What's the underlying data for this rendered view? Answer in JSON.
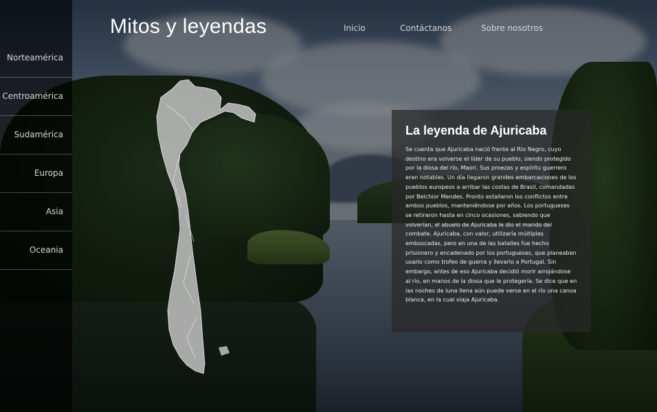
{
  "site": {
    "title": "Mitos y leyendas"
  },
  "top_nav": [
    {
      "label": "Inicio"
    },
    {
      "label": "Contáctanos"
    },
    {
      "label": "Sobre nosotros"
    }
  ],
  "sidebar": {
    "items": [
      {
        "label": "Norteamérica"
      },
      {
        "label": "Centroamérica"
      },
      {
        "label": "Sudamérica"
      },
      {
        "label": "Europa"
      },
      {
        "label": "Asia"
      },
      {
        "label": "Oceania"
      }
    ]
  },
  "map": {
    "icon": "south-america-map-icon",
    "fill": "#c9c9c9"
  },
  "legend": {
    "title": "La leyenda de Ajuricaba",
    "text": "Se cuenta que Ajuricaba nació frente al Río Negro, cuyo destino era volverse el líder de su pueblo, siendo protegido por la diosa del río, Maori. Sus proezas y espíritu guerrero eran notables. Un día llegaron grandes embarcaciones de los pueblos europeos a arribar las costas de Brasil, comandadas por Belchior Mendes. Pronto estallaron los conflictos entre ambos pueblos, manteniéndose por años. Los portugueses se retiraron hasta en cinco ocasiones, sabiendo que volverían, el abuelo de Ajuricaba le dio el mando del combate. Ajuricaba, con valor, utilizaría múltiples emboscadas, pero en una de las batalles fue hecho prisionero y encadenado por los portugueses, que planeaban usarlo como trofeo de guerra y llevarlo a Portugal. Sin embargo, antes de eso Ajuricaba decidió morir arrojándose al río, en manos de la diosa que le protegería. Se dice que en las noches de luna llena aún puede verse en el río una canoa blanca, en la cual viaja Ajuricaba."
  },
  "colors": {
    "sidebar_bg": "#000000",
    "card_bg": "#282828",
    "text": "#ffffff"
  }
}
